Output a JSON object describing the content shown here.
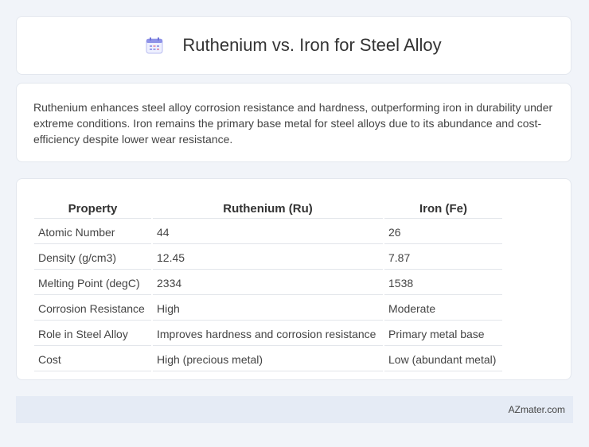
{
  "header": {
    "title": "Ruthenium vs. Iron for Steel Alloy",
    "icon": "calendar-icon"
  },
  "summary": {
    "text": "Ruthenium enhances steel alloy corrosion resistance and hardness, outperforming iron in durability under extreme conditions. Iron remains the primary base metal for steel alloys due to its abundance and cost-efficiency despite lower wear resistance."
  },
  "table": {
    "headers": [
      "Property",
      "Ruthenium (Ru)",
      "Iron (Fe)"
    ],
    "rows": [
      [
        "Atomic Number",
        "44",
        "26"
      ],
      [
        "Density (g/cm3)",
        "12.45",
        "7.87"
      ],
      [
        "Melting Point (degC)",
        "2334",
        "1538"
      ],
      [
        "Corrosion Resistance",
        "High",
        "Moderate"
      ],
      [
        "Role in Steel Alloy",
        "Improves hardness and corrosion resistance",
        "Primary metal base"
      ],
      [
        "Cost",
        "High (precious metal)",
        "Low (abundant metal)"
      ]
    ]
  },
  "footer": {
    "text": "AZmater.com"
  },
  "colors": {
    "page_background": "#f1f4f9",
    "card_background": "#ffffff",
    "footer_background": "#e5ebf5",
    "icon_accent": "#7b7fe0"
  }
}
